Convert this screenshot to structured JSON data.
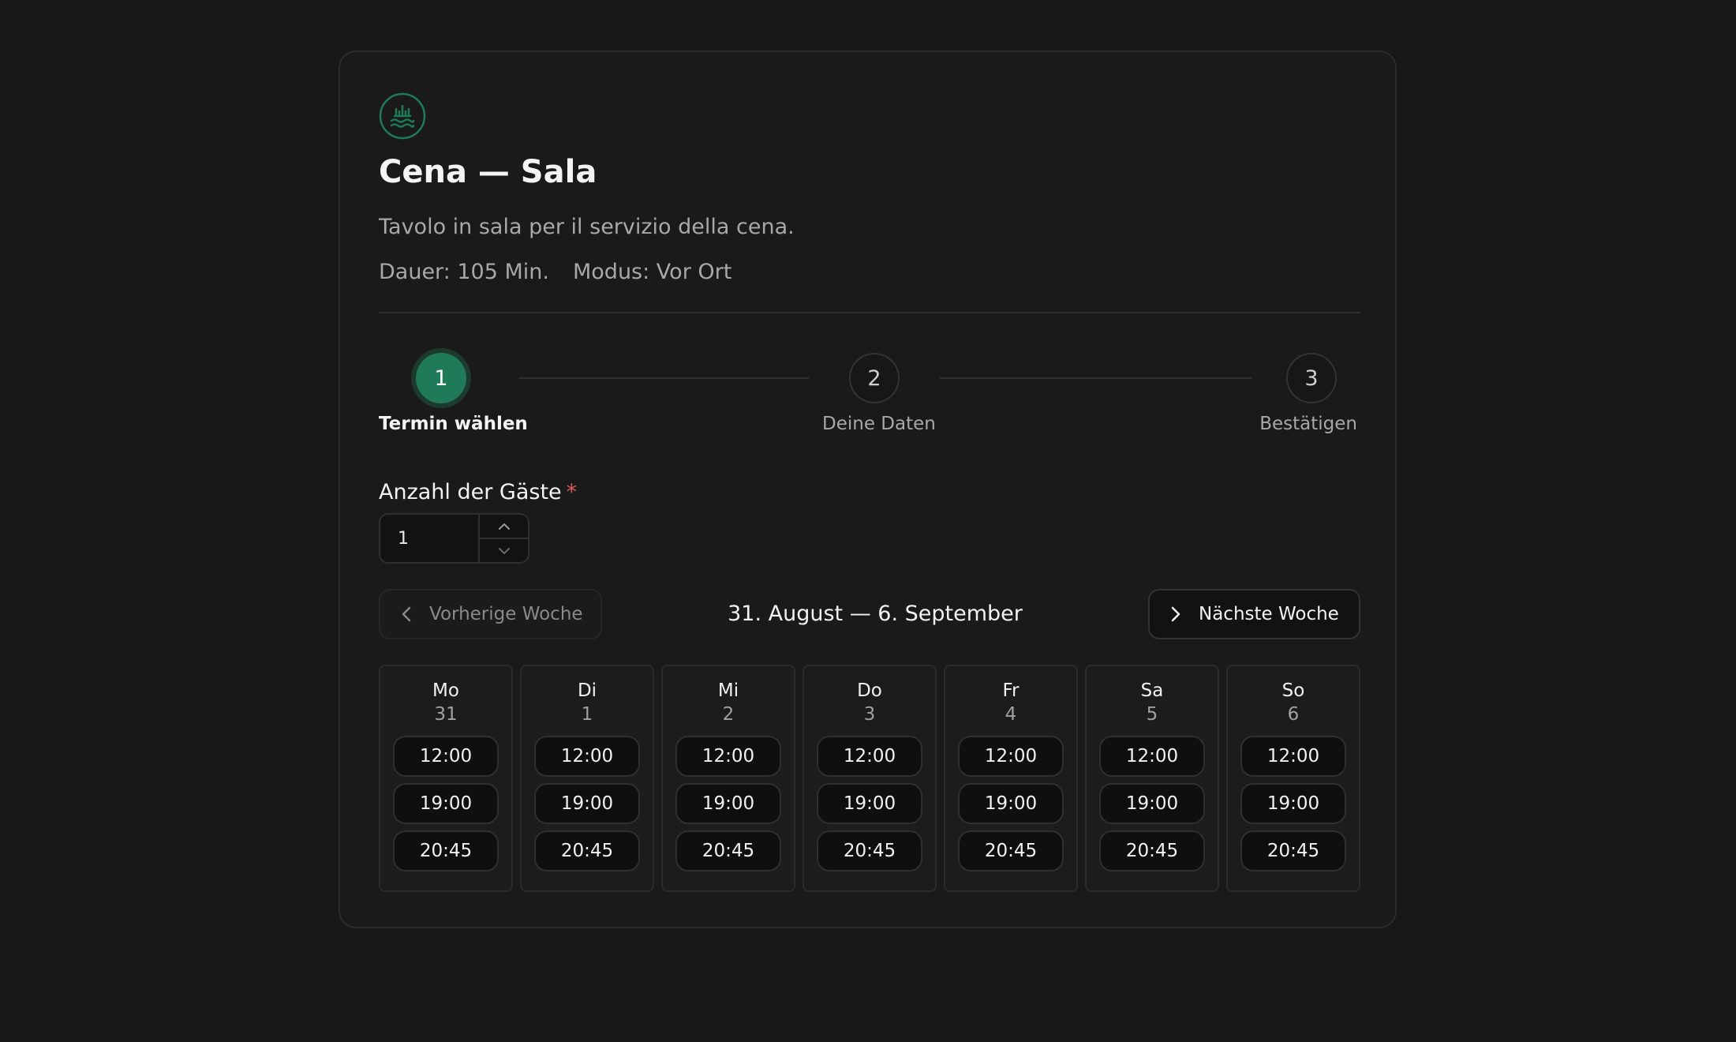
{
  "event": {
    "title": "Cena — Sala",
    "description": "Tavolo in sala per il servizio della cena.",
    "duration": "Dauer: 105 Min.",
    "mode": "Modus: Vor Ort",
    "logo_icon": "restaurant-logo-icon",
    "accent_color": "#1f7a57"
  },
  "steps": [
    {
      "number": "1",
      "label": "Termin wählen",
      "active": true
    },
    {
      "number": "2",
      "label": "Deine Daten",
      "active": false
    },
    {
      "number": "3",
      "label": "Bestätigen",
      "active": false
    }
  ],
  "guests": {
    "label": "Anzahl der Gäste",
    "required_mark": "*",
    "value": "1"
  },
  "week_nav": {
    "prev_label": "Vorherige Woche",
    "next_label": "Nächste Woche",
    "range": "31. August — 6. September"
  },
  "days": [
    {
      "name": "Mo",
      "date": "31",
      "slots": [
        "12:00",
        "19:00",
        "20:45"
      ]
    },
    {
      "name": "Di",
      "date": "1",
      "slots": [
        "12:00",
        "19:00",
        "20:45"
      ]
    },
    {
      "name": "Mi",
      "date": "2",
      "slots": [
        "12:00",
        "19:00",
        "20:45"
      ]
    },
    {
      "name": "Do",
      "date": "3",
      "slots": [
        "12:00",
        "19:00",
        "20:45"
      ]
    },
    {
      "name": "Fr",
      "date": "4",
      "slots": [
        "12:00",
        "19:00",
        "20:45"
      ]
    },
    {
      "name": "Sa",
      "date": "5",
      "slots": [
        "12:00",
        "19:00",
        "20:45"
      ]
    },
    {
      "name": "So",
      "date": "6",
      "slots": [
        "12:00",
        "19:00",
        "20:45"
      ]
    }
  ]
}
